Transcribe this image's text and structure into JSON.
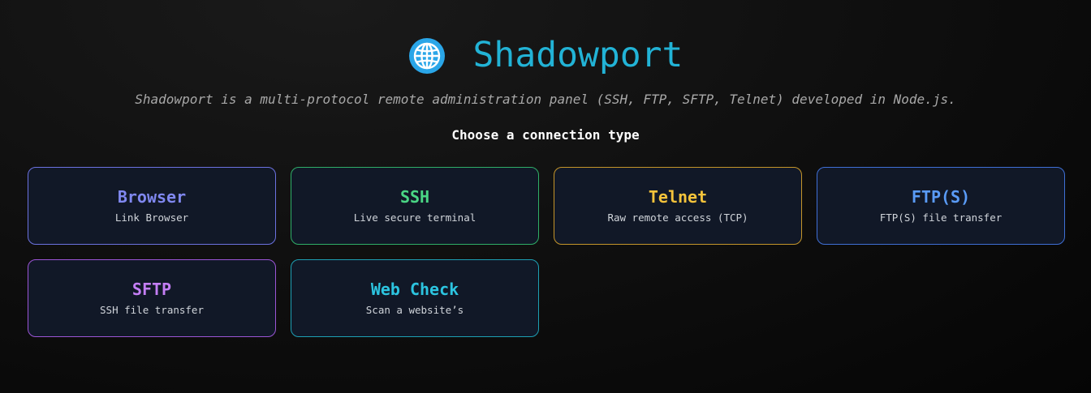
{
  "header": {
    "icon": "globe-icon",
    "title": "Shadowport"
  },
  "description": "Shadowport is a multi-protocol remote administration panel (SSH, FTP, SFTP, Telnet) developed in Node.js.",
  "choose_label": "Choose a connection type",
  "cards": [
    {
      "name": "Browser",
      "subtitle": "Link Browser",
      "color": "#8088f0",
      "border": "#6c72e0"
    },
    {
      "name": "SSH",
      "subtitle": "Live secure terminal",
      "color": "#4ad685",
      "border": "#2fae68"
    },
    {
      "name": "Telnet",
      "subtitle": "Raw remote access (TCP)",
      "color": "#f5c33b",
      "border": "#c4952a"
    },
    {
      "name": "FTP(S)",
      "subtitle": "FTP(S) file transfer",
      "color": "#5a9bf6",
      "border": "#3f6fd6"
    },
    {
      "name": "SFTP",
      "subtitle": "SSH file transfer",
      "color": "#c47ef5",
      "border": "#9b55d6"
    },
    {
      "name": "Web Check",
      "subtitle": "Scan a website’s",
      "color": "#2cc4e0",
      "border": "#1d9fb4"
    }
  ],
  "colors": {
    "background": "#0a0a0a",
    "title": "#22b3d6",
    "card_background": "#111827"
  }
}
